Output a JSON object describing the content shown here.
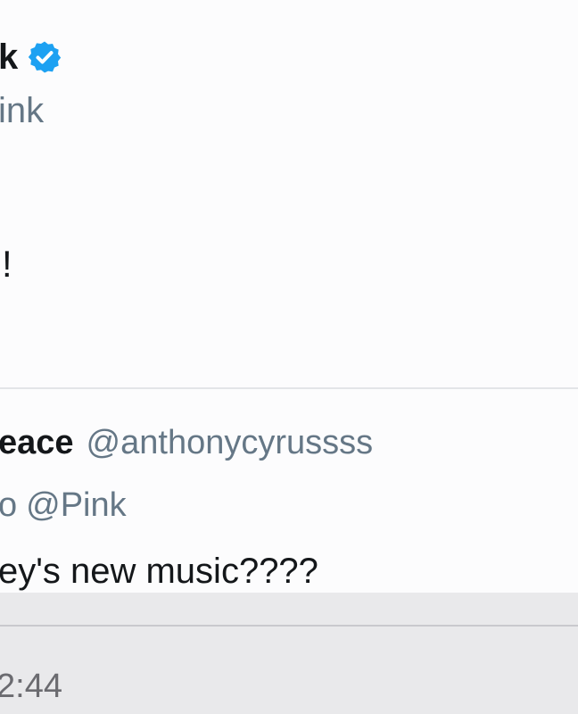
{
  "tweet": {
    "name_fragment": "k",
    "handle_fragment": "ink",
    "body_fragment": "!",
    "verified_color": "#1da1f2"
  },
  "reply": {
    "name_fragment": "eace",
    "handle": "@anthonycyrussss",
    "reply_to_prefix": "o",
    "reply_to_mention": "@Pink",
    "body_fragment": "ey's new music????"
  },
  "status": {
    "time_fragment": "2:44"
  },
  "icons": {
    "verified": "verified-badge-icon"
  }
}
